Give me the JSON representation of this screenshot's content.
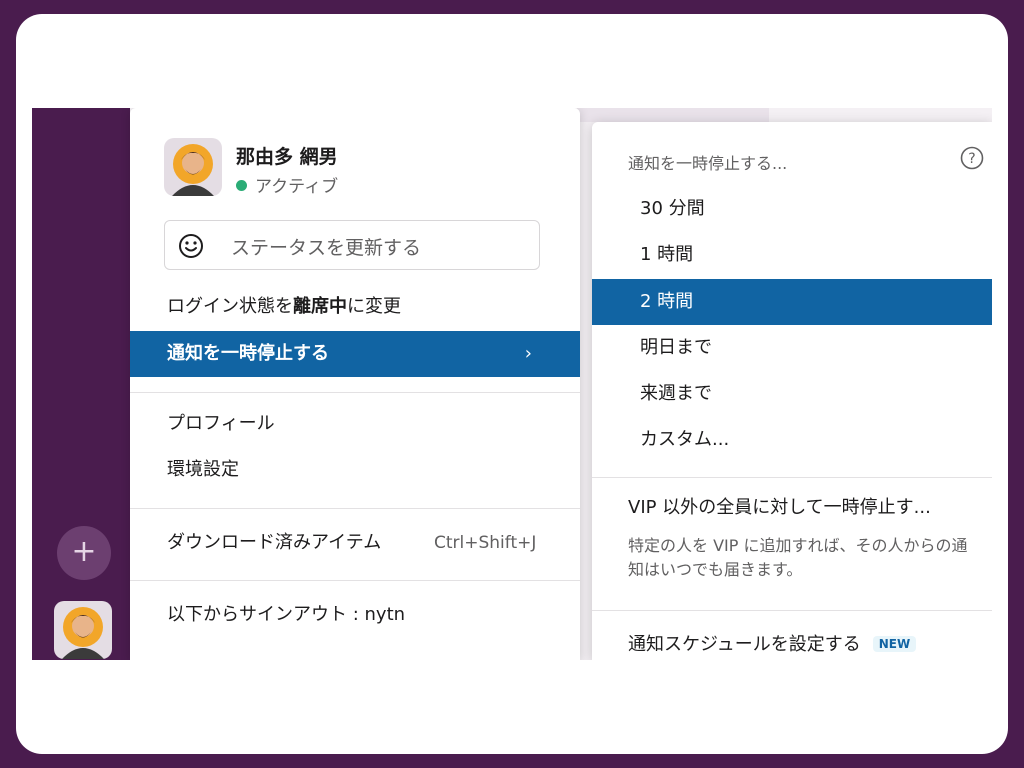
{
  "user": {
    "name": "那由多 網男",
    "status": "アクティブ",
    "status_color": "#2bac76"
  },
  "status_input": {
    "placeholder": "ステータスを更新する"
  },
  "menu": {
    "login_prefix": "ログイン状態を",
    "login_bold": "離席中",
    "login_suffix": "に変更",
    "pause": "通知を一時停止する",
    "pause_chevron": "›",
    "profile": "プロフィール",
    "preferences": "環境設定",
    "downloads": "ダウンロード済みアイテム",
    "downloads_shortcut": "Ctrl+Shift+J",
    "signout": "以下からサインアウト : nytn"
  },
  "submenu": {
    "header": "通知を一時停止する...",
    "options": [
      "30 分間",
      "1 時間",
      "2 時間",
      "明日まで",
      "来週まで",
      "カスタム..."
    ],
    "selected_index": 2,
    "vip_title": "VIP 以外の全員に対して一時停止す...",
    "vip_desc": "特定の人を VIP に追加すれば、その人からの通知はいつでも届きます。",
    "schedule": "通知スケジュールを設定する",
    "new_badge": "NEW"
  },
  "rail": {
    "add_label": "+"
  },
  "colors": {
    "accent": "#1164a3",
    "sidebar": "#4a1c4e"
  }
}
